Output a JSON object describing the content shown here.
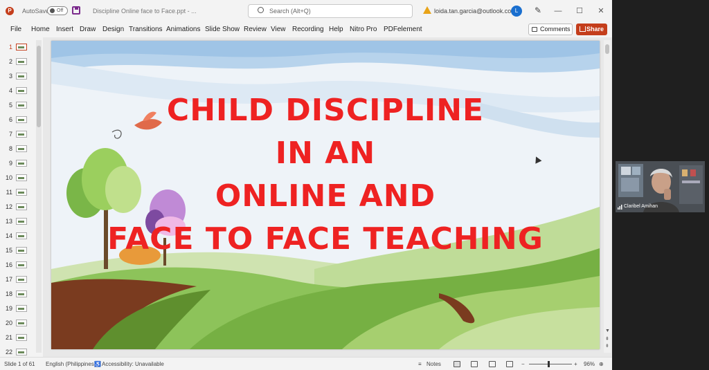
{
  "titlebar": {
    "app_logo": "P",
    "autosave_label": "AutoSave",
    "autosave_state": "Off",
    "document_title": "Discipline Online face to Face.ppt  -  ...",
    "search_placeholder": "Search (Alt+Q)",
    "account_email": "loida.tan.garcia@outlook.com",
    "avatar_initial": "L",
    "minimize": "—",
    "maximize": "☐",
    "close": "✕"
  },
  "ribbon": {
    "tabs": [
      "File",
      "Home",
      "Insert",
      "Draw",
      "Design",
      "Transitions",
      "Animations",
      "Slide Show",
      "Review",
      "View",
      "Recording",
      "Help",
      "Nitro Pro",
      "PDFelement"
    ],
    "comments_label": "Comments",
    "share_label": "Share"
  },
  "thumbnails": {
    "numbers": [
      "1",
      "2",
      "3",
      "4",
      "5",
      "6",
      "7",
      "8",
      "9",
      "10",
      "11",
      "12",
      "13",
      "14",
      "15",
      "16",
      "17",
      "18",
      "19",
      "20",
      "21",
      "22"
    ],
    "selected": 1
  },
  "slide": {
    "title_lines": [
      "CHILD DISCIPLINE",
      "IN AN",
      "ONLINE AND",
      "FACE TO FACE TEACHING"
    ]
  },
  "statusbar": {
    "slide_counter": "Slide 1 of 61",
    "language": "English (Philippines)",
    "accessibility": "Accessibility: Unavailable",
    "notes_label": "Notes",
    "zoom_level": "96%",
    "zoom_fraction": 0.48
  },
  "video": {
    "participant_name": "Claribel Amihan"
  },
  "colors": {
    "accent": "#c43e1c",
    "title_red": "#ee2222"
  }
}
